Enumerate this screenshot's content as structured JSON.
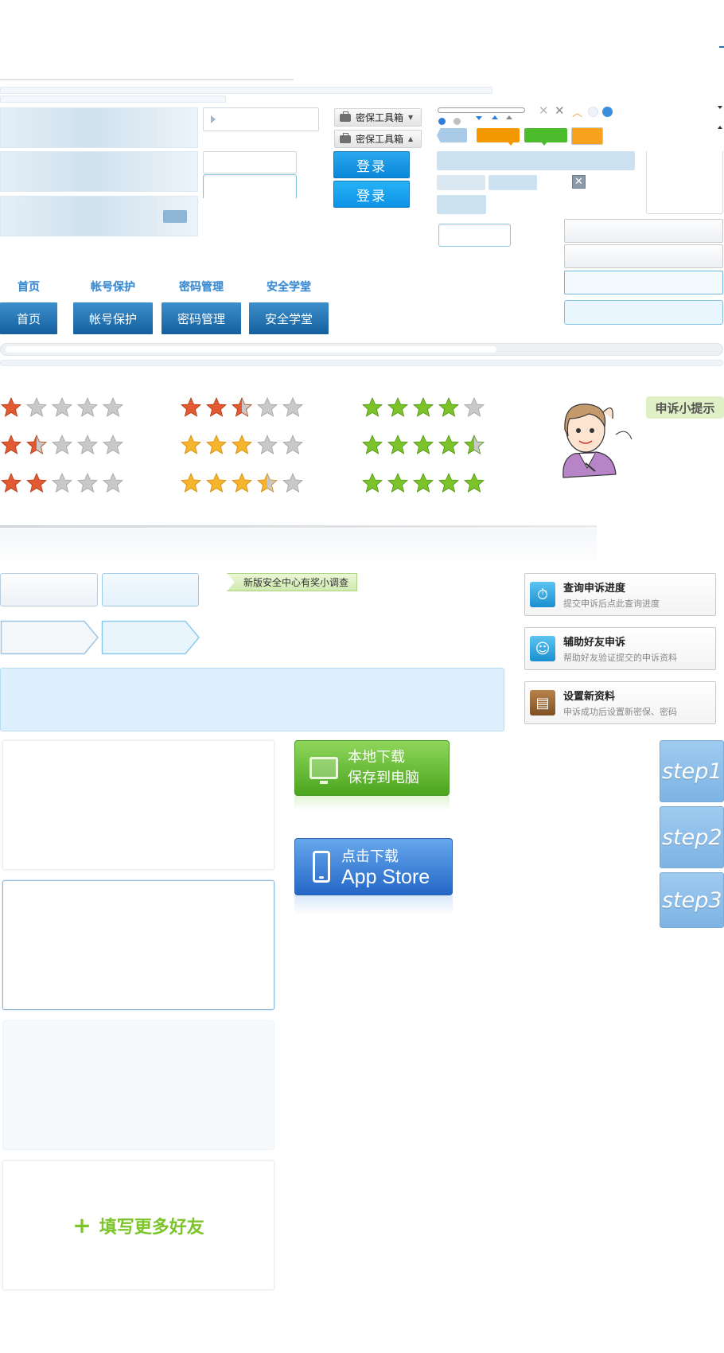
{
  "toolbox": {
    "label_down": "密保工具箱",
    "label_up": "密保工具箱"
  },
  "login": {
    "label_1": "登录",
    "label_2": "登录"
  },
  "nav": {
    "items": [
      "首页",
      "帐号保护",
      "密码管理",
      "安全学堂"
    ],
    "items_hover": [
      "首页",
      "帐号保护",
      "密码管理",
      "安全学堂"
    ]
  },
  "ratings": {
    "red": [
      1,
      1.5,
      2
    ],
    "mixed_red": [
      2.5
    ],
    "gold": [
      3,
      3.5
    ],
    "green": [
      4,
      4.5,
      5
    ]
  },
  "tip": {
    "label": "申诉小提示"
  },
  "survey": {
    "label": "新版安全中心有奖小调查"
  },
  "cards": [
    {
      "title": "查询申诉进度",
      "sub": "提交申诉后点此查询进度",
      "icon": "progress-icon",
      "color": "#2a9fd8"
    },
    {
      "title": "辅助好友申诉",
      "sub": "帮助好友验证提交的申诉资料",
      "icon": "smile-icon",
      "color": "#26a6e0"
    },
    {
      "title": "设置新资料",
      "sub": "申诉成功后设置新密保、密码",
      "icon": "clipboard-icon",
      "color": "#9a6a3a"
    }
  ],
  "download": {
    "local_line1": "本地下载",
    "local_line2": "保存到电脑",
    "app_line1": "点击下载",
    "app_line2": "App Store"
  },
  "steps": [
    "step1",
    "step2",
    "step3"
  ],
  "add_friend": {
    "label": "填写更多好友",
    "plus": "+"
  },
  "colors": {
    "accent_blue": "#0a86d8",
    "nav_blue": "#15609e",
    "orange": "#f39800",
    "green": "#4cbb2c",
    "light_blue": "#cde2f0",
    "add_green": "#7cc429"
  }
}
